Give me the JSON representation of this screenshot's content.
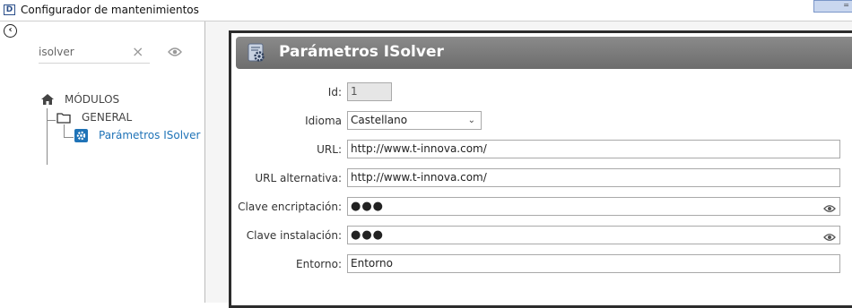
{
  "window": {
    "title": "Configurador de mantenimientos",
    "app_icon_letter": "D",
    "control_glyph": "="
  },
  "sidebar": {
    "back_icon": "chevron-left-icon",
    "search": {
      "value": "isolver",
      "clear_icon": "close-icon",
      "toggle_icon": "eye-icon"
    },
    "tree": {
      "root": {
        "label": "MÓDULOS",
        "icon": "home-icon"
      },
      "group": {
        "label": "GENERAL",
        "icon": "folder-icon"
      },
      "item": {
        "label": "Parámetros ISolver",
        "icon": "gear-icon",
        "selected": true
      }
    }
  },
  "panel": {
    "title": "Parámetros ISolver",
    "icon": "settings-panel-icon",
    "fields": {
      "id": {
        "label": "Id:",
        "value": "1"
      },
      "idioma": {
        "label": "Idioma",
        "value": "Castellano"
      },
      "url": {
        "label": "URL:",
        "value": "http://www.t-innova.com/"
      },
      "url_alt": {
        "label": "URL alternativa:",
        "value": "http://www.t-innova.com/"
      },
      "clave_enc": {
        "label": "Clave encriptación:",
        "value": "●●●"
      },
      "clave_inst": {
        "label": "Clave instalación:",
        "value": "●●●"
      },
      "entorno": {
        "label": "Entorno:",
        "value": "Entorno"
      }
    }
  },
  "colors": {
    "header_bg": "#777777",
    "selected_item": "#1f73b7",
    "panel_border": "#2c2c2c"
  }
}
